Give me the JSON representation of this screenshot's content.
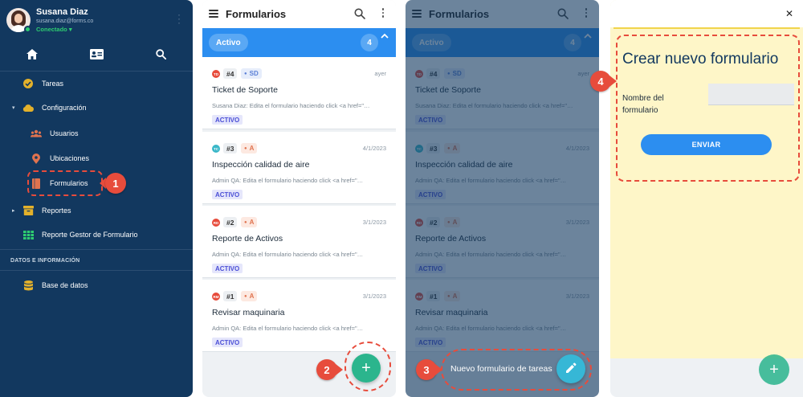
{
  "sidebar": {
    "user_name": "Susana Diaz",
    "user_email": "susana.diaz@forms.co",
    "user_status": "Conectado",
    "top_nav": [
      "home-icon",
      "id-card-icon",
      "search-icon"
    ],
    "items": [
      {
        "label": "Tareas",
        "icon": "check-circle-icon"
      },
      {
        "label": "Configuración",
        "icon": "cloud-icon"
      },
      {
        "label": "Usuarios",
        "icon": "users-icon"
      },
      {
        "label": "Ubicaciones",
        "icon": "pin-icon"
      },
      {
        "label": "Formularios",
        "icon": "book-icon"
      },
      {
        "label": "Reportes",
        "icon": "archive-icon"
      },
      {
        "label": "Reporte Gestor de Formulario",
        "icon": "grid-icon"
      },
      {
        "label": "Base de datos",
        "icon": "database-icon"
      }
    ],
    "section_label": "DATOS E INFORMACIÓN",
    "callout": "1"
  },
  "list": {
    "title": "Formularios",
    "tab_label": "Activo",
    "tab_count": "4",
    "cards": [
      {
        "initials": "TD",
        "avatar_color": "#e74c3c",
        "number": "#4",
        "assignee": "SD",
        "assignee_color": "#5a7fd6",
        "assignee_bg": "#e6edfb",
        "date": "ayer",
        "title": "Ticket de Soporte",
        "desc": "Susana Diaz: Edita el formulario haciendo click <a href=\"…",
        "status": "ACTIVO"
      },
      {
        "initials": "TC",
        "avatar_color": "#3ab7c8",
        "number": "#3",
        "assignee": "A",
        "assignee_color": "#e0734f",
        "assignee_bg": "#fde9e1",
        "date": "4/1/2023",
        "title": "Inspección calidad de aire",
        "desc": "Admin QA: Edita el formulario haciendo click <a href=\"…",
        "status": "ACTIVO"
      },
      {
        "initials": "RD",
        "avatar_color": "#e74c3c",
        "number": "#2",
        "assignee": "A",
        "assignee_color": "#e0734f",
        "assignee_bg": "#fde9e1",
        "date": "3/1/2023",
        "title": "Reporte de Activos",
        "desc": "Admin QA: Edita el formulario haciendo click <a href=\"…",
        "status": "ACTIVO"
      },
      {
        "initials": "RM",
        "avatar_color": "#e74c3c",
        "number": "#1",
        "assignee": "A",
        "assignee_color": "#e0734f",
        "assignee_bg": "#fde9e1",
        "date": "3/1/2023",
        "title": "Revisar maquinaria",
        "desc": "Admin QA: Edita el formulario haciendo click <a href=\"…",
        "status": "ACTIVO"
      }
    ],
    "fab_icon": "plus-icon",
    "callout": "2"
  },
  "overlay": {
    "fab_label": "Nuevo formulario de tareas",
    "fab_icon": "pencil-icon",
    "callout": "3"
  },
  "create": {
    "title": "Crear nuevo formulario",
    "field_label": "Nombre del formulario",
    "field_value": "",
    "submit_label": "ENVIAR",
    "close_icon": "close-icon",
    "callout": "4"
  },
  "colors": {
    "sidebar_bg": "#12385f",
    "accent_blue": "#2c8ef0",
    "fab_green": "#2bb58d",
    "highlight_red": "#e74c3c",
    "form_bg": "#fef6c8"
  }
}
